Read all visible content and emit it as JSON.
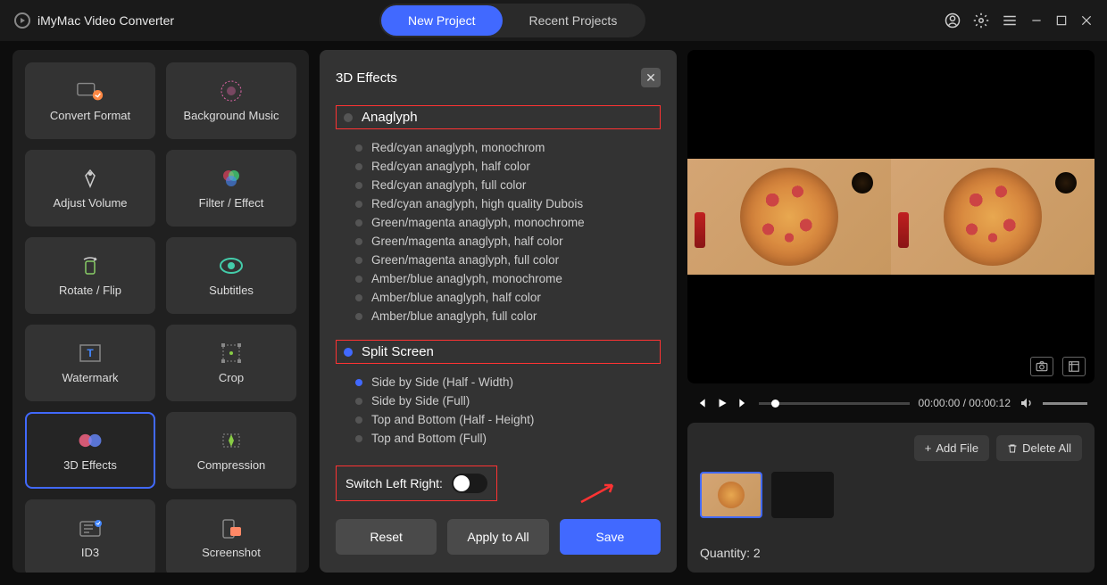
{
  "app": {
    "title": "iMyMac Video Converter"
  },
  "tabs": {
    "new_project": "New Project",
    "recent_projects": "Recent Projects"
  },
  "tools": [
    {
      "id": "convert-format",
      "label": "Convert Format"
    },
    {
      "id": "background-music",
      "label": "Background Music"
    },
    {
      "id": "adjust-volume",
      "label": "Adjust Volume"
    },
    {
      "id": "filter-effect",
      "label": "Filter / Effect"
    },
    {
      "id": "rotate-flip",
      "label": "Rotate / Flip"
    },
    {
      "id": "subtitles",
      "label": "Subtitles"
    },
    {
      "id": "watermark",
      "label": "Watermark"
    },
    {
      "id": "crop",
      "label": "Crop"
    },
    {
      "id": "3d-effects",
      "label": "3D Effects",
      "selected": true
    },
    {
      "id": "compression",
      "label": "Compression"
    },
    {
      "id": "id3",
      "label": "ID3"
    },
    {
      "id": "screenshot",
      "label": "Screenshot"
    }
  ],
  "panel": {
    "title": "3D Effects",
    "groups": {
      "anaglyph": {
        "title": "Anaglyph",
        "active": false,
        "options": [
          "Red/cyan anaglyph, monochrom",
          "Red/cyan anaglyph, half color",
          "Red/cyan anaglyph, full color",
          "Red/cyan anaglyph, high quality Dubois",
          "Green/magenta anaglyph, monochrome",
          "Green/magenta anaglyph, half color",
          "Green/magenta anaglyph, full color",
          "Amber/blue anaglyph, monochrome",
          "Amber/blue anaglyph, half color",
          "Amber/blue anaglyph, full color"
        ]
      },
      "split_screen": {
        "title": "Split Screen",
        "active": true,
        "options": [
          {
            "label": "Side by Side (Half - Width)",
            "selected": true
          },
          {
            "label": "Side by Side (Full)",
            "selected": false
          },
          {
            "label": "Top and Bottom (Half - Height)",
            "selected": false
          },
          {
            "label": "Top and Bottom (Full)",
            "selected": false
          }
        ]
      }
    },
    "switch_label": "Switch Left Right:",
    "actions": {
      "reset": "Reset",
      "apply_all": "Apply to All",
      "save": "Save"
    }
  },
  "player": {
    "time_current": "00:00:00",
    "time_total": "00:00:12"
  },
  "files": {
    "add_file": "Add File",
    "delete_all": "Delete All",
    "quantity_label": "Quantity:",
    "quantity_value": "2"
  }
}
